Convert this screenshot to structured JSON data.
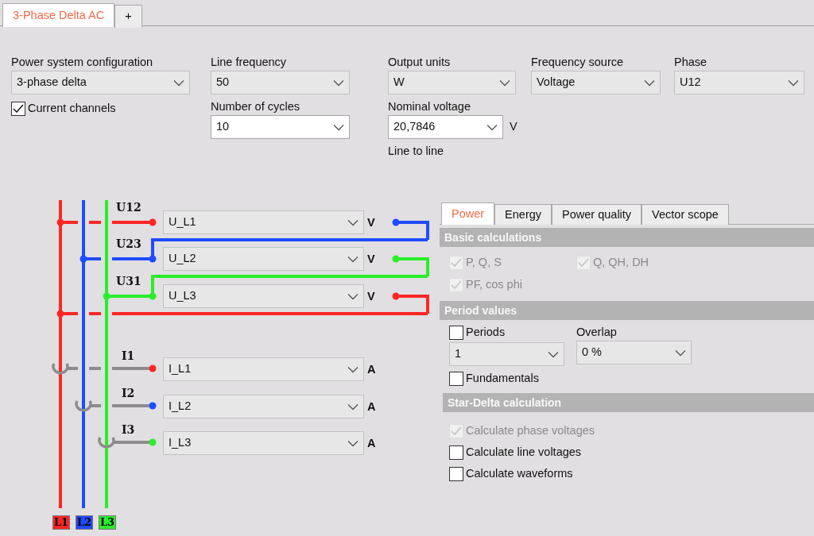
{
  "document_tabs": [
    {
      "label": "3-Phase Delta AC",
      "selected": true
    },
    {
      "label": "+",
      "selected": false
    }
  ],
  "settings": {
    "power_system_configuration": {
      "label": "Power system configuration",
      "value": "3-phase delta",
      "kind": "dropdown"
    },
    "current_channels": {
      "label": "Current channels",
      "checked": true
    },
    "line_frequency": {
      "label": "Line frequency",
      "value": "50",
      "kind": "dropdown"
    },
    "number_of_cycles": {
      "label": "Number of cycles",
      "value": "10",
      "kind": "combo"
    },
    "output_units": {
      "label": "Output units",
      "value": "W",
      "kind": "dropdown"
    },
    "nominal_voltage": {
      "label": "Nominal voltage",
      "value": "20,7846",
      "kind": "combo",
      "unit": "V",
      "note": "Line to line"
    },
    "frequency_source": {
      "label": "Frequency source",
      "value": "Voltage",
      "kind": "dropdown"
    },
    "phase": {
      "label": "Phase",
      "value": "U12",
      "kind": "dropdown"
    }
  },
  "diagram": {
    "lines": [
      {
        "label": "L1",
        "color": "#ff2626"
      },
      {
        "label": "L2",
        "color": "#1f4cff"
      },
      {
        "label": "L3",
        "color": "#2aee2a"
      }
    ],
    "voltage_channels": [
      {
        "label": "U12",
        "value": "U_L1",
        "unit": "V"
      },
      {
        "label": "U23",
        "value": "U_L2",
        "unit": "V"
      },
      {
        "label": "U31",
        "value": "U_L3",
        "unit": "V"
      }
    ],
    "current_channels": [
      {
        "label": "I1",
        "value": "I_L1",
        "unit": "A"
      },
      {
        "label": "I2",
        "value": "I_L2",
        "unit": "A"
      },
      {
        "label": "I3",
        "value": "I_L3",
        "unit": "A"
      }
    ]
  },
  "calc_tabs": [
    {
      "label": "Power",
      "selected": true
    },
    {
      "label": "Energy",
      "selected": false
    },
    {
      "label": "Power quality",
      "selected": false
    },
    {
      "label": "Vector scope",
      "selected": false
    }
  ],
  "basic_calculations": {
    "title": "Basic calculations",
    "items": [
      {
        "label": "P, Q, S",
        "checked": true,
        "disabled": true
      },
      {
        "label": "Q, QH, DH",
        "checked": true,
        "disabled": true
      },
      {
        "label": "PF, cos phi",
        "checked": true,
        "disabled": true
      }
    ]
  },
  "period_values": {
    "title": "Period values",
    "periods": {
      "label": "Periods",
      "checked": false,
      "disabled": false
    },
    "periods_value": "1",
    "overlap": {
      "label": "Overlap",
      "value": "0 %"
    },
    "fundamentals": {
      "label": "Fundamentals",
      "checked": false,
      "disabled": false
    }
  },
  "star_delta_calculation": {
    "title": "Star-Delta calculation",
    "items": [
      {
        "label": "Calculate phase voltages",
        "checked": true,
        "disabled": true
      },
      {
        "label": "Calculate line voltages",
        "checked": false,
        "disabled": false
      },
      {
        "label": "Calculate waveforms",
        "checked": false,
        "disabled": false
      }
    ]
  }
}
